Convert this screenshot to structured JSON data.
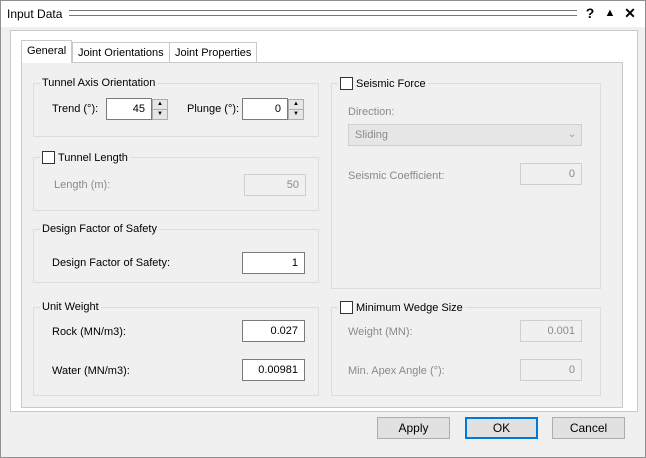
{
  "window": {
    "title": "Input Data",
    "help_label": "?",
    "collapse_label": "▲",
    "close_label": "✕"
  },
  "tabs": [
    {
      "label": "General",
      "active": true
    },
    {
      "label": "Joint Orientations",
      "active": false
    },
    {
      "label": "Joint Properties",
      "active": false
    }
  ],
  "tunnel_axis": {
    "title": "Tunnel Axis Orientation",
    "trend_label": "Trend (°):",
    "trend_value": "45",
    "plunge_label": "Plunge (°):",
    "plunge_value": "0"
  },
  "tunnel_length": {
    "title": "Tunnel Length",
    "checked": false,
    "length_label": "Length (m):",
    "length_value": "50"
  },
  "design_fos": {
    "title": "Design Factor of Safety",
    "label": "Design Factor of Safety:",
    "value": "1"
  },
  "unit_weight": {
    "title": "Unit Weight",
    "rock_label": "Rock (MN/m3):",
    "rock_value": "0.027",
    "water_label": "Water (MN/m3):",
    "water_value": "0.00981"
  },
  "seismic": {
    "title": "Seismic Force",
    "checked": false,
    "direction_label": "Direction:",
    "direction_value": "Sliding",
    "coefficient_label": "Seismic Coefficient:",
    "coefficient_value": "0"
  },
  "min_wedge": {
    "title": "Minimum Wedge Size",
    "checked": false,
    "weight_label": "Weight (MN):",
    "weight_value": "0.001",
    "apex_label": "Min. Apex Angle (°):",
    "apex_value": "0"
  },
  "buttons": {
    "apply": "Apply",
    "ok": "OK",
    "cancel": "Cancel"
  }
}
